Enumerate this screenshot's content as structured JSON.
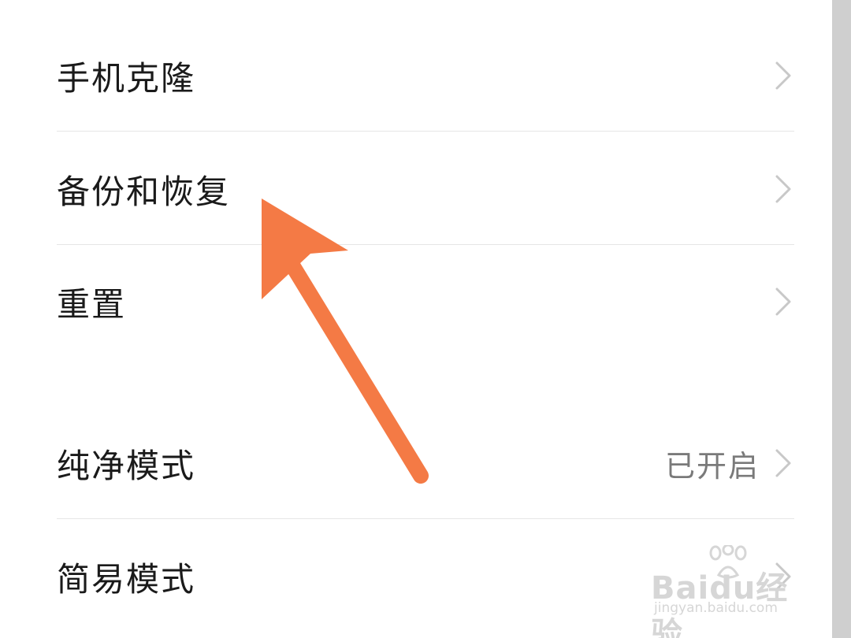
{
  "settings": {
    "items": [
      {
        "label": "手机克隆",
        "value": ""
      },
      {
        "label": "备份和恢复",
        "value": ""
      },
      {
        "label": "重置",
        "value": ""
      },
      {
        "label": "纯净模式",
        "value": "已开启"
      },
      {
        "label": "简易模式",
        "value": ""
      }
    ]
  },
  "annotation": {
    "arrow_color": "#f47a45",
    "target": "备份和恢复"
  },
  "watermark": {
    "brand": "Baidu经验",
    "url": "jingyan.baidu.com"
  },
  "colors": {
    "text": "#1a1a1a",
    "secondary": "#7a7a7a",
    "divider": "#e6e6e6",
    "chevron": "#c8c8c8"
  }
}
